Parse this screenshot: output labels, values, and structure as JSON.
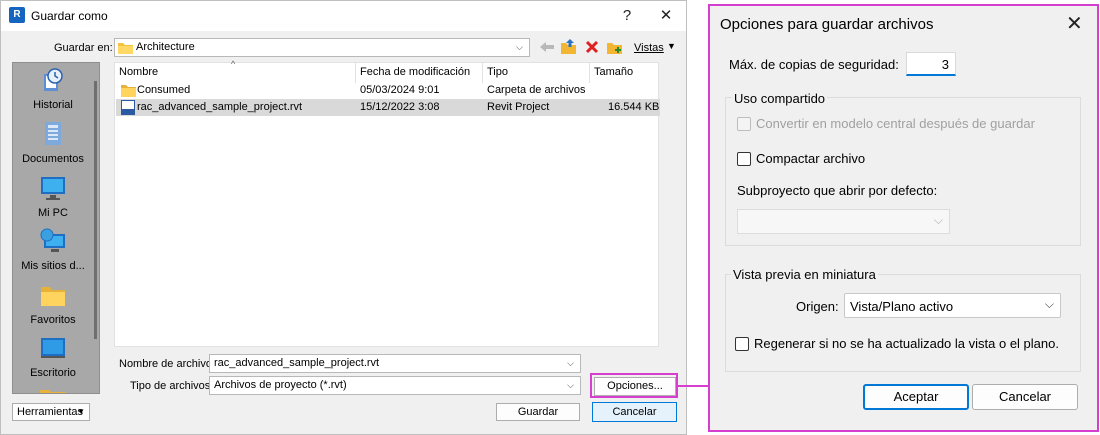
{
  "save_dialog": {
    "title": "Guardar como",
    "help_glyph": "?",
    "close_glyph": "✕",
    "save_in_label": "Guardar en:",
    "save_in_value": "Architecture",
    "views_label": "Vistas",
    "places": [
      {
        "label": "Historial",
        "icon": "history-icon"
      },
      {
        "label": "Documentos",
        "icon": "documents-icon"
      },
      {
        "label": "Mi PC",
        "icon": "computer-icon"
      },
      {
        "label": "Mis sitios d...",
        "icon": "network-places-icon"
      },
      {
        "label": "Favoritos",
        "icon": "favorites-folder-icon"
      },
      {
        "label": "Escritorio",
        "icon": "desktop-icon"
      }
    ],
    "columns": [
      "Nombre",
      "Fecha de modificación",
      "Tipo",
      "Tamaño"
    ],
    "files": [
      {
        "name": "Consumed",
        "modified": "05/03/2024 9:01",
        "type": "Carpeta de archivos",
        "size": "",
        "icon": "folder-icon"
      },
      {
        "name": "rac_advanced_sample_project.rvt",
        "modified": "15/12/2022 3:08",
        "type": "Revit Project",
        "size": "16.544 KB",
        "icon": "revit-file-icon"
      }
    ],
    "filename_label": "Nombre de archivo:",
    "filename_value": "rac_advanced_sample_project.rvt",
    "filetype_label": "Tipo de archivos:",
    "filetype_value": "Archivos de proyecto (*.rvt)",
    "tools_label": "Herramientas",
    "options_label": "Opciones...",
    "save_label": "Guardar",
    "cancel_label": "Cancelar"
  },
  "options_dialog": {
    "title": "Opciones para guardar archivos",
    "close_glyph": "✕",
    "max_backups_label": "Máx. de copias de seguridad:",
    "max_backups_value": "3",
    "worksharing_group": "Uso compartido",
    "make_central_label": "Convertir en modelo central después de guardar",
    "compact_label": "Compactar archivo",
    "workset_label": "Subproyecto que abrir por defecto:",
    "workset_value": "",
    "thumbnail_group": "Vista previa en miniatura",
    "source_label": "Origen:",
    "source_value": "Vista/Plano activo",
    "regenerate_label": "Regenerar si no se ha actualizado la vista o el plano.",
    "ok_label": "Aceptar",
    "cancel_label": "Cancelar"
  },
  "colors": {
    "highlight": "#d63ed0",
    "focus_blue": "#0078d7",
    "selection_gray": "#d9d9d9"
  }
}
